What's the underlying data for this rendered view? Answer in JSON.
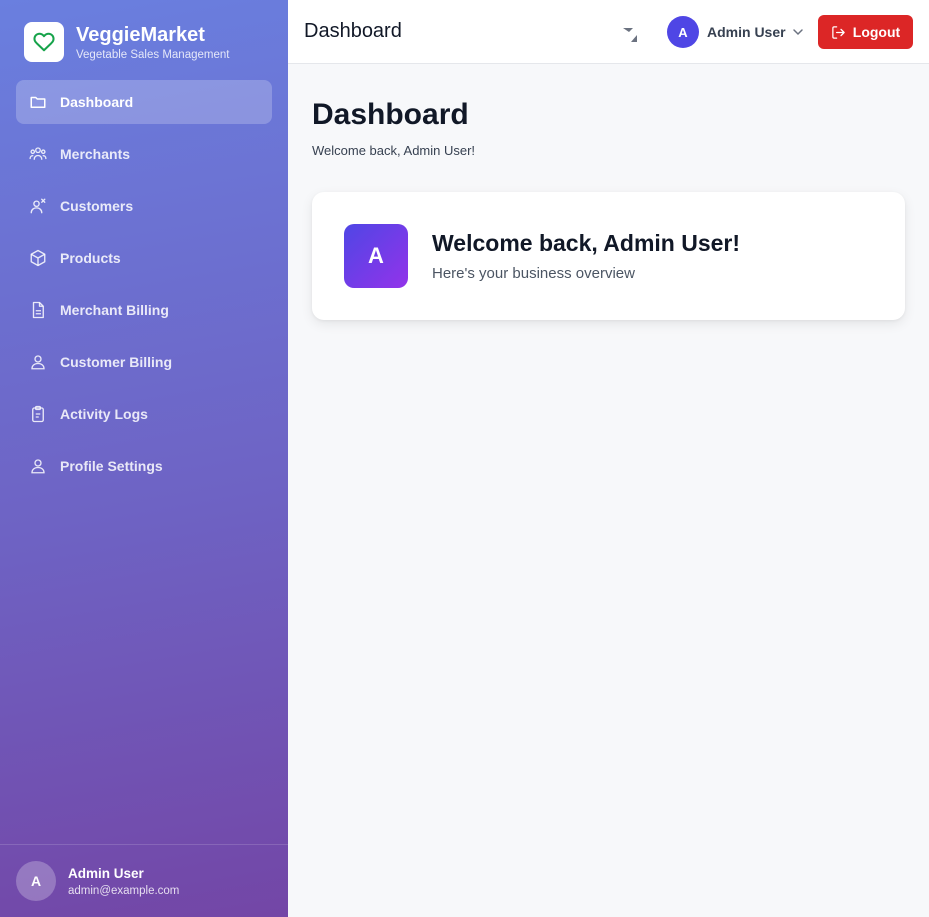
{
  "brand": {
    "title": "VeggieMarket",
    "subtitle": "Vegetable Sales Management",
    "logo_icon": "heart-icon",
    "logo_color": "#16a34a"
  },
  "sidebar": {
    "items": [
      {
        "label": "Dashboard",
        "icon": "folder-icon",
        "active": true
      },
      {
        "label": "Merchants",
        "icon": "users-icon"
      },
      {
        "label": "Customers",
        "icon": "user-x-icon"
      },
      {
        "label": "Products",
        "icon": "box-icon"
      },
      {
        "label": "Merchant Billing",
        "icon": "document-icon"
      },
      {
        "label": "Customer Billing",
        "icon": "user-icon"
      },
      {
        "label": "Activity Logs",
        "icon": "clipboard-icon"
      },
      {
        "label": "Profile Settings",
        "icon": "user-icon"
      }
    ],
    "footer": {
      "avatar_initial": "A",
      "name": "Admin User",
      "email": "admin@example.com"
    }
  },
  "topbar": {
    "title": "Dashboard",
    "user": {
      "avatar_initial": "A",
      "name": "Admin User"
    },
    "logout_label": "Logout",
    "colors": {
      "avatar": "#4f46e5",
      "logout": "#dc2626"
    }
  },
  "main": {
    "title": "Dashboard",
    "subtitle": "Welcome back, Admin User!",
    "welcome_card": {
      "avatar_initial": "A",
      "title": "Welcome back, Admin User!",
      "subtitle": "Here's your business overview"
    }
  }
}
